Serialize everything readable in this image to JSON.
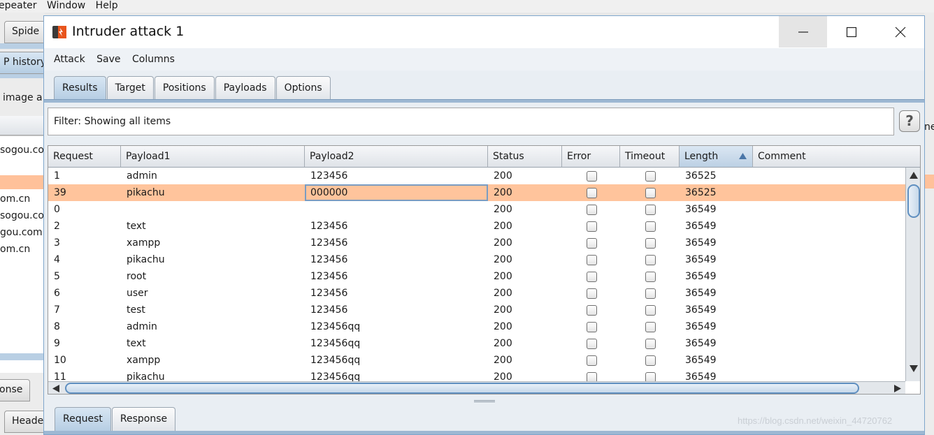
{
  "background": {
    "menu": [
      "epeater",
      "Window",
      "Help"
    ],
    "tabs": [
      "Spide",
      "P history"
    ],
    "filter_fragment": "image a",
    "list_items": [
      "sogou.co",
      "om.cn",
      "sogou.co",
      "gou.com",
      "om.cn"
    ],
    "bottom_tabs": [
      "onse",
      "Heade"
    ],
    "right_fragment": "ne"
  },
  "window": {
    "title": "Intruder attack 1",
    "controls": {
      "minimize": "minimize-icon",
      "maximize": "maximize-icon",
      "close": "close-icon"
    }
  },
  "menu": [
    "Attack",
    "Save",
    "Columns"
  ],
  "tabs": [
    "Results",
    "Target",
    "Positions",
    "Payloads",
    "Options"
  ],
  "filter": {
    "text": "Filter:  Showing all items"
  },
  "help_label": "?",
  "table": {
    "columns": [
      "Request",
      "Payload1",
      "Payload2",
      "Status",
      "Error",
      "Timeout",
      "Length",
      "Comment"
    ],
    "rows": [
      {
        "request": "1",
        "payload1": "admin",
        "payload2": "123456",
        "status": "200",
        "length": "36525"
      },
      {
        "request": "39",
        "payload1": "pikachu",
        "payload2": "000000",
        "status": "200",
        "length": "36525"
      },
      {
        "request": "0",
        "payload1": "",
        "payload2": "",
        "status": "200",
        "length": "36549"
      },
      {
        "request": "2",
        "payload1": "text",
        "payload2": "123456",
        "status": "200",
        "length": "36549"
      },
      {
        "request": "3",
        "payload1": "xampp",
        "payload2": "123456",
        "status": "200",
        "length": "36549"
      },
      {
        "request": "4",
        "payload1": "pikachu",
        "payload2": "123456",
        "status": "200",
        "length": "36549"
      },
      {
        "request": "5",
        "payload1": "root",
        "payload2": "123456",
        "status": "200",
        "length": "36549"
      },
      {
        "request": "6",
        "payload1": "user",
        "payload2": "123456",
        "status": "200",
        "length": "36549"
      },
      {
        "request": "7",
        "payload1": "test",
        "payload2": "123456",
        "status": "200",
        "length": "36549"
      },
      {
        "request": "8",
        "payload1": "admin",
        "payload2": "123456qq",
        "status": "200",
        "length": "36549"
      },
      {
        "request": "9",
        "payload1": "text",
        "payload2": "123456qq",
        "status": "200",
        "length": "36549"
      },
      {
        "request": "10",
        "payload1": "xampp",
        "payload2": "123456qq",
        "status": "200",
        "length": "36549"
      },
      {
        "request": "11",
        "payload1": "pikachu",
        "payload2": "123456qq",
        "status": "200",
        "length": "36549"
      }
    ]
  },
  "bottom_tabs": [
    "Request",
    "Response"
  ],
  "watermark": "https://blog.csdn.net/weixin_44720762",
  "colors": {
    "selected_row": "#ffc49c",
    "accent": "#5f8fc0",
    "logo": "#e8541c"
  }
}
